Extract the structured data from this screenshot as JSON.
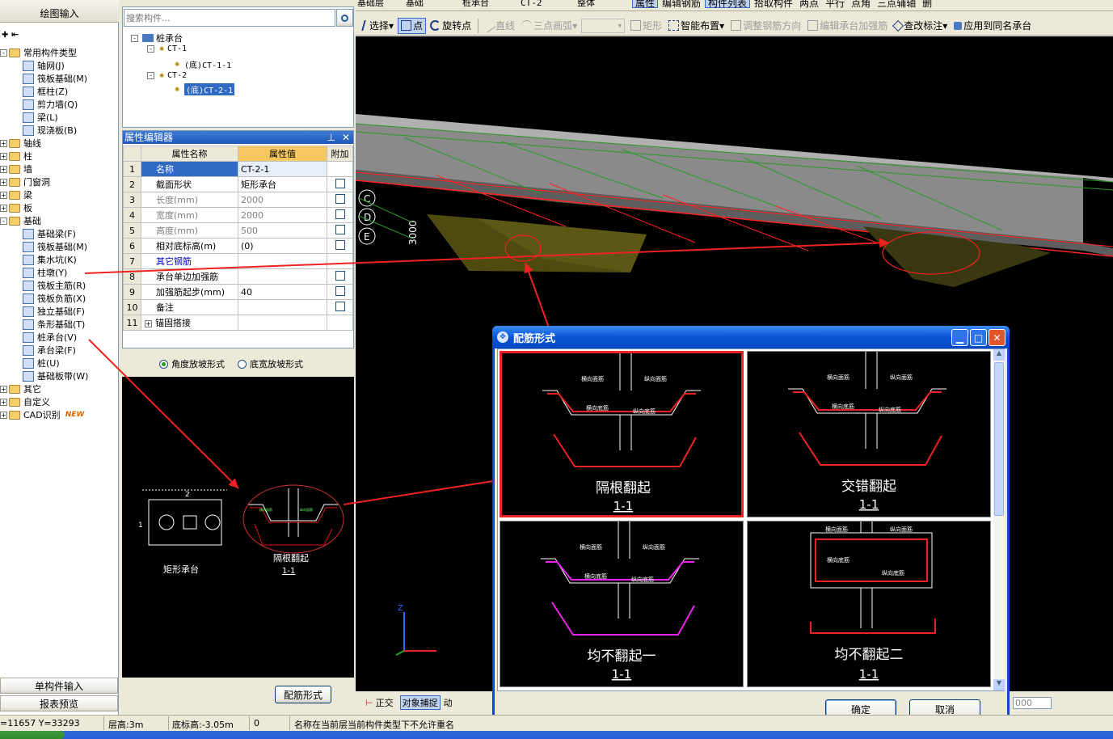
{
  "top_toolbar": {
    "layer_dd": "基础层",
    "type_dd": "基础",
    "category_dd": "桩承台",
    "element_dd": "CT-2",
    "sub_dd": "整体",
    "btn_property": "属性",
    "btn_edit_rebar": "编辑钢筋",
    "btn_element_list": "构件列表",
    "btn_pick": "拾取构件",
    "btn_two_point": "两点",
    "btn_parallel": "平行",
    "btn_point_angle": "点角",
    "btn_three_point_aux": "三点辅轴",
    "btn_delete_trunc": "删"
  },
  "draw_toolbar": {
    "select": "选择",
    "point": "点",
    "rotate_point": "旋转点",
    "line": "直线",
    "arc3": "三点画弧",
    "rect": "矩形",
    "smart_place": "智能布置",
    "adjust_dir": "调整钢筋方向",
    "edit_cap_rebar": "编辑承台加强筋",
    "check_mark": "查改标注",
    "apply_same": "应用到同名承台"
  },
  "left_panel": {
    "title_top": "绘图输入",
    "tree": [
      {
        "label": "常用构件类型",
        "level": 0,
        "type": "folder",
        "exp": "-"
      },
      {
        "label": "轴网(J)",
        "level": 1,
        "type": "item"
      },
      {
        "label": "筏板基础(M)",
        "level": 1,
        "type": "item"
      },
      {
        "label": "框柱(Z)",
        "level": 1,
        "type": "item"
      },
      {
        "label": "剪力墙(Q)",
        "level": 1,
        "type": "item"
      },
      {
        "label": "梁(L)",
        "level": 1,
        "type": "item"
      },
      {
        "label": "现浇板(B)",
        "level": 1,
        "type": "item"
      },
      {
        "label": "轴线",
        "level": 0,
        "type": "folder",
        "exp": "+"
      },
      {
        "label": "柱",
        "level": 0,
        "type": "folder",
        "exp": "+"
      },
      {
        "label": "墙",
        "level": 0,
        "type": "folder",
        "exp": "+"
      },
      {
        "label": "门窗洞",
        "level": 0,
        "type": "folder",
        "exp": "+"
      },
      {
        "label": "梁",
        "level": 0,
        "type": "folder",
        "exp": "+"
      },
      {
        "label": "板",
        "level": 0,
        "type": "folder",
        "exp": "+"
      },
      {
        "label": "基础",
        "level": 0,
        "type": "folder",
        "exp": "-"
      },
      {
        "label": "基础梁(F)",
        "level": 1,
        "type": "item"
      },
      {
        "label": "筏板基础(M)",
        "level": 1,
        "type": "item"
      },
      {
        "label": "集水坑(K)",
        "level": 1,
        "type": "item"
      },
      {
        "label": "柱墩(Y)",
        "level": 1,
        "type": "item"
      },
      {
        "label": "筏板主筋(R)",
        "level": 1,
        "type": "item"
      },
      {
        "label": "筏板负筋(X)",
        "level": 1,
        "type": "item"
      },
      {
        "label": "独立基础(F)",
        "level": 1,
        "type": "item"
      },
      {
        "label": "条形基础(T)",
        "level": 1,
        "type": "item"
      },
      {
        "label": "桩承台(V)",
        "level": 1,
        "type": "item"
      },
      {
        "label": "承台梁(F)",
        "level": 1,
        "type": "item"
      },
      {
        "label": "桩(U)",
        "level": 1,
        "type": "item"
      },
      {
        "label": "基础板带(W)",
        "level": 1,
        "type": "item"
      },
      {
        "label": "其它",
        "level": 0,
        "type": "folder",
        "exp": "+"
      },
      {
        "label": "自定义",
        "level": 0,
        "type": "folder",
        "exp": "+"
      },
      {
        "label": "CAD识别",
        "level": 0,
        "type": "folder",
        "exp": "+"
      }
    ],
    "new_badge": "NEW",
    "btn_single": "单构件输入",
    "btn_report": "报表预览"
  },
  "component_list": {
    "search_placeholder": "搜索构件...",
    "root": "桩承台",
    "ct1": "CT-1",
    "ct1_child": "(底)CT-1-1",
    "ct2": "CT-2",
    "ct2_child": "(底)CT-2-1"
  },
  "prop_editor": {
    "title": "属性编辑器",
    "h_name": "属性名称",
    "h_value": "属性值",
    "h_extra": "附加",
    "rows": [
      {
        "n": "1",
        "name": "名称",
        "value": "CT-2-1",
        "chk": false,
        "gray": false,
        "blue": false
      },
      {
        "n": "2",
        "name": "截面形状",
        "value": "矩形承台",
        "chk": true,
        "gray": false,
        "blue": false
      },
      {
        "n": "3",
        "name": "长度(mm)",
        "value": "2000",
        "chk": true,
        "gray": true,
        "blue": false
      },
      {
        "n": "4",
        "name": "宽度(mm)",
        "value": "2000",
        "chk": true,
        "gray": true,
        "blue": false
      },
      {
        "n": "5",
        "name": "高度(mm)",
        "value": "500",
        "chk": true,
        "gray": true,
        "blue": false
      },
      {
        "n": "6",
        "name": "相对底标高(m)",
        "value": "(0)",
        "chk": true,
        "gray": false,
        "blue": false
      },
      {
        "n": "7",
        "name": "其它钢筋",
        "value": "",
        "chk": false,
        "gray": false,
        "blue": true
      },
      {
        "n": "8",
        "name": "承台单边加强筋",
        "value": "",
        "chk": true,
        "gray": false,
        "blue": false
      },
      {
        "n": "9",
        "name": "加强筋起步(mm)",
        "value": "40",
        "chk": true,
        "gray": false,
        "blue": false
      },
      {
        "n": "10",
        "name": "备注",
        "value": "",
        "chk": true,
        "gray": false,
        "blue": false
      },
      {
        "n": "11",
        "name": "锚固搭接",
        "value": "",
        "chk": false,
        "gray": false,
        "blue": false
      }
    ],
    "radio1": "角度放坡形式",
    "radio2": "底宽放坡形式",
    "preview_label1": "矩形承台",
    "preview_label2": "隔根翻起",
    "preview_label3": "1-1",
    "dim_2": "2",
    "dim_1": "1",
    "btn_rebar_form": "配筋形式"
  },
  "viewport": {
    "axis_c": "C",
    "axis_d": "D",
    "axis_e": "E",
    "dim_3000": "3000",
    "bottom_ortho": "正交",
    "bottom_snap": "对象捕捉",
    "bottom_dyn": "动",
    "bottom_val": "000"
  },
  "dialog": {
    "title": "配筋形式",
    "options": [
      {
        "label": "隔根翻起",
        "sub": "1-1",
        "selected": true
      },
      {
        "label": "交错翻起",
        "sub": "1-1",
        "selected": false
      },
      {
        "label": "均不翻起一",
        "sub": "1-1",
        "selected": false
      },
      {
        "label": "均不翻起二",
        "sub": "1-1",
        "selected": false
      }
    ],
    "lbl_top_x": "横向面筋",
    "lbl_top_y": "纵向面筋",
    "lbl_bot_x": "横向底筋",
    "lbl_bot_y": "纵向底筋",
    "ok": "确定",
    "cancel": "取消"
  },
  "status_bar": {
    "coords": "=11657 Y=33293",
    "floor_height": "层高:3m",
    "bottom_elev": "底标高:-3.05m",
    "zero": "0",
    "message": "名称在当前层当前构件类型下不允许重名"
  }
}
